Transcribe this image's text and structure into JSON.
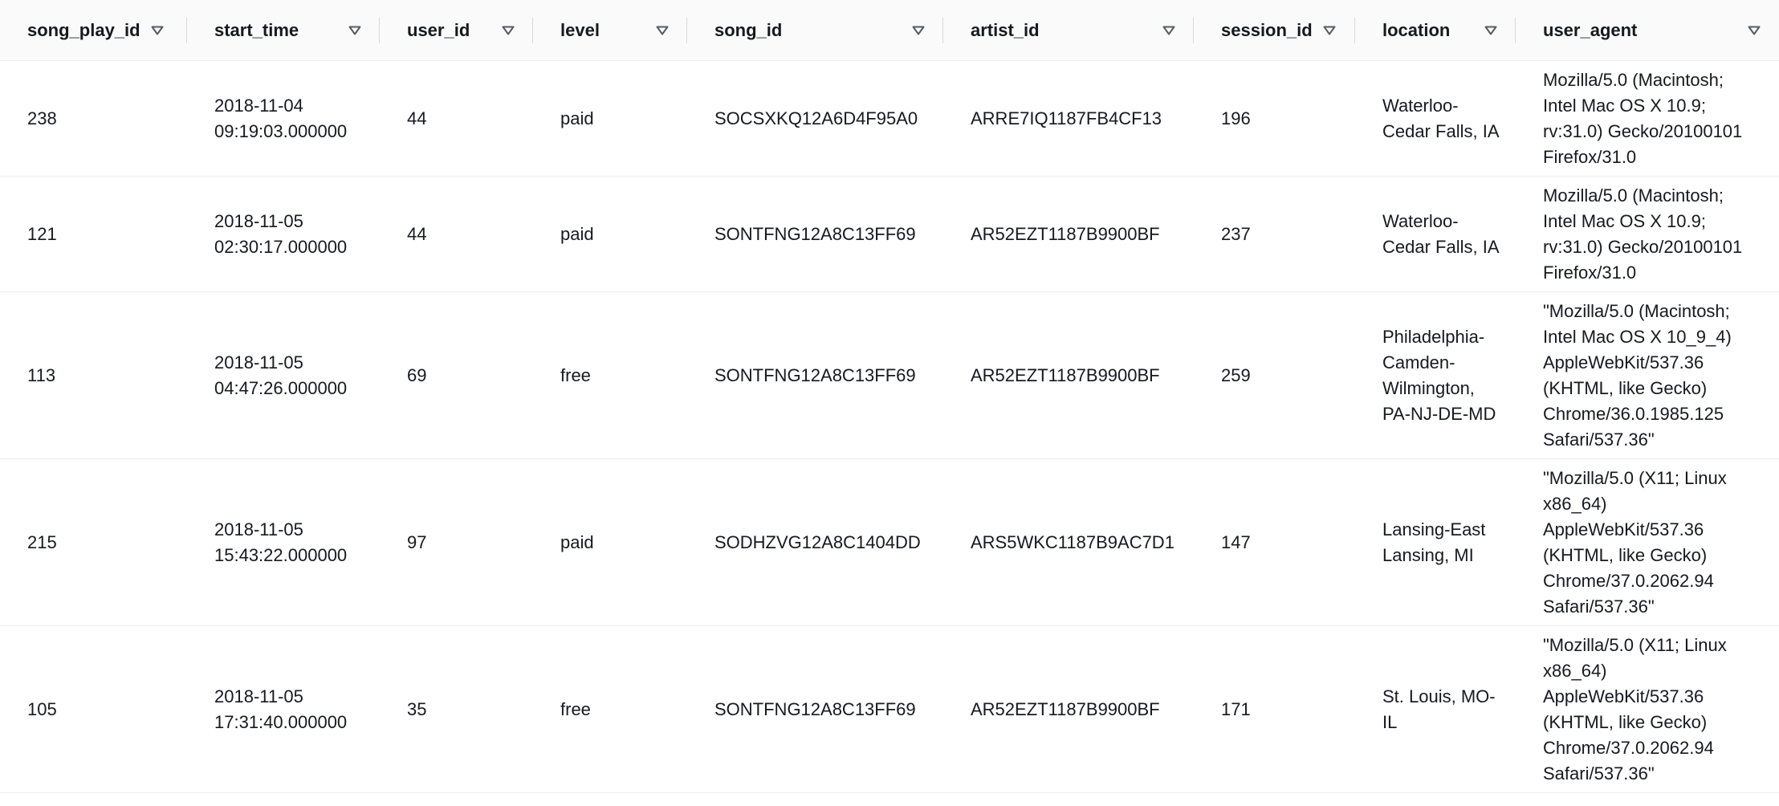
{
  "table": {
    "columns": [
      {
        "key": "song_play_id",
        "label": "song_play_id"
      },
      {
        "key": "start_time",
        "label": "start_time"
      },
      {
        "key": "user_id",
        "label": "user_id"
      },
      {
        "key": "level",
        "label": "level"
      },
      {
        "key": "song_id",
        "label": "song_id"
      },
      {
        "key": "artist_id",
        "label": "artist_id"
      },
      {
        "key": "session_id",
        "label": "session_id"
      },
      {
        "key": "location",
        "label": "location"
      },
      {
        "key": "user_agent",
        "label": "user_agent"
      }
    ],
    "rows": [
      {
        "song_play_id": "238",
        "start_time": "2018-11-04 09:19:03.000000",
        "user_id": "44",
        "level": "paid",
        "song_id": "SOCSXKQ12A6D4F95A0",
        "artist_id": "ARRE7IQ1187FB4CF13",
        "session_id": "196",
        "location": "Waterloo-Cedar Falls, IA",
        "user_agent": "Mozilla/5.0 (Macintosh; Intel Mac OS X 10.9; rv:31.0) Gecko/20100101 Firefox/31.0"
      },
      {
        "song_play_id": "121",
        "start_time": "2018-11-05 02:30:17.000000",
        "user_id": "44",
        "level": "paid",
        "song_id": "SONTFNG12A8C13FF69",
        "artist_id": "AR52EZT1187B9900BF",
        "session_id": "237",
        "location": "Waterloo-Cedar Falls, IA",
        "user_agent": "Mozilla/5.0 (Macintosh; Intel Mac OS X 10.9; rv:31.0) Gecko/20100101 Firefox/31.0"
      },
      {
        "song_play_id": "113",
        "start_time": "2018-11-05 04:47:26.000000",
        "user_id": "69",
        "level": "free",
        "song_id": "SONTFNG12A8C13FF69",
        "artist_id": "AR52EZT1187B9900BF",
        "session_id": "259",
        "location": "Philadelphia-Camden-Wilmington, PA-NJ-DE-MD",
        "user_agent": "\"Mozilla/5.0 (Macintosh; Intel Mac OS X 10_9_4) AppleWebKit/537.36 (KHTML, like Gecko) Chrome/36.0.1985.125 Safari/537.36\""
      },
      {
        "song_play_id": "215",
        "start_time": "2018-11-05 15:43:22.000000",
        "user_id": "97",
        "level": "paid",
        "song_id": "SODHZVG12A8C1404DD",
        "artist_id": "ARS5WKC1187B9AC7D1",
        "session_id": "147",
        "location": "Lansing-East Lansing, MI",
        "user_agent": "\"Mozilla/5.0 (X11; Linux x86_64) AppleWebKit/537.36 (KHTML, like Gecko) Chrome/37.0.2062.94 Safari/537.36\""
      },
      {
        "song_play_id": "105",
        "start_time": "2018-11-05 17:31:40.000000",
        "user_id": "35",
        "level": "free",
        "song_id": "SONTFNG12A8C13FF69",
        "artist_id": "AR52EZT1187B9900BF",
        "session_id": "171",
        "location": "St. Louis, MO-IL",
        "user_agent": "\"Mozilla/5.0 (X11; Linux x86_64) AppleWebKit/537.36 (KHTML, like Gecko) Chrome/37.0.2062.94 Safari/537.36\""
      }
    ]
  },
  "icons": {
    "sort": "sort-descending-triangle-icon"
  },
  "colors": {
    "header_bg": "#fafafa",
    "text": "#16191f",
    "divider": "#eaeded",
    "icon": "#545b64"
  }
}
